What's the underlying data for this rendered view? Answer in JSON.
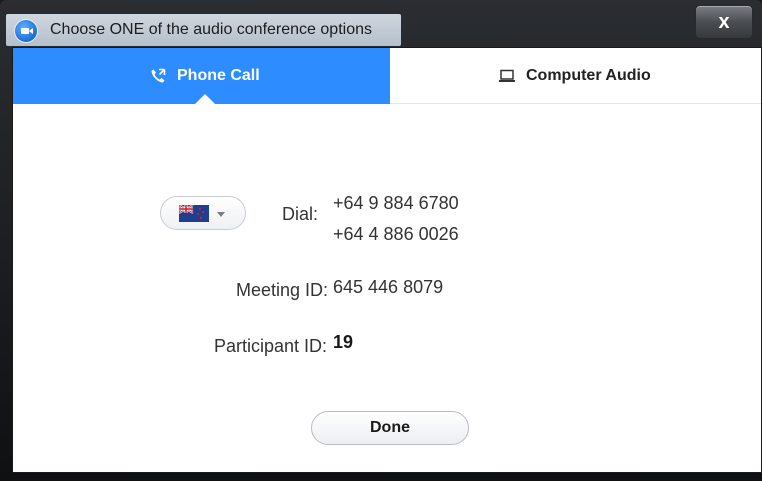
{
  "window": {
    "title": "Choose ONE of the audio conference options",
    "close_label": "x"
  },
  "tabs": [
    {
      "label": "Phone Call",
      "icon": "phone-icon",
      "selected": true
    },
    {
      "label": "Computer Audio",
      "icon": "laptop-icon",
      "selected": false
    }
  ],
  "phone": {
    "country_flag": "new-zealand-flag-icon",
    "dial_label": "Dial:",
    "dial_numbers": [
      "+64 9 884 6780",
      "+64 4 886 0026"
    ],
    "meeting_label": "Meeting ID:",
    "meeting_id": "645 446 8079",
    "participant_label": "Participant ID:",
    "participant_id": "19",
    "done_label": "Done"
  },
  "colors": {
    "accent": "#2d8cff",
    "text": "#333333",
    "tab_inactive_bg": "#ffffff"
  }
}
